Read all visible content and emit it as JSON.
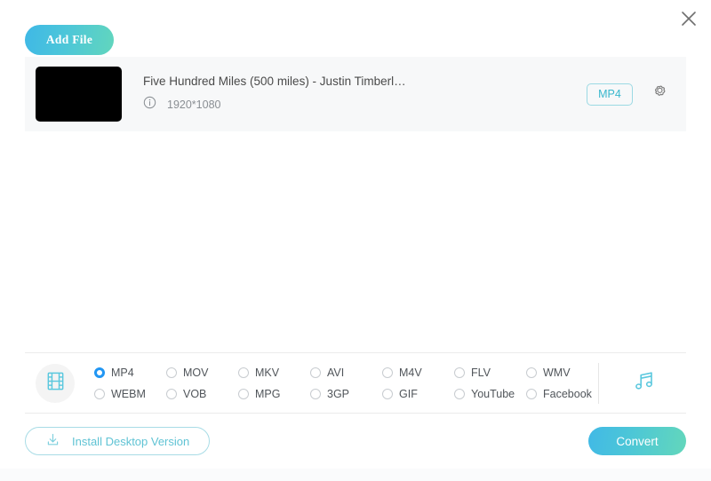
{
  "window": {
    "close_label": "×",
    "close_icon": "close-icon"
  },
  "toolbar": {
    "add_file_label": "Add File"
  },
  "file_list": {
    "items": [
      {
        "title": "Five Hundred Miles (500 miles) - Justin Timberl…",
        "resolution": "1920*1080",
        "format_badge": "MP4",
        "info_icon": "info-circle-icon",
        "settings_icon": "gear-icon",
        "thumbnail": "video-thumbnail"
      }
    ]
  },
  "format_section": {
    "video_icon": "film-strip-icon",
    "audio_icon": "music-note-icon",
    "selected": "MP4",
    "options": [
      {
        "label": "MP4",
        "selected": true
      },
      {
        "label": "MOV",
        "selected": false
      },
      {
        "label": "MKV",
        "selected": false
      },
      {
        "label": "AVI",
        "selected": false
      },
      {
        "label": "M4V",
        "selected": false
      },
      {
        "label": "FLV",
        "selected": false
      },
      {
        "label": "WMV",
        "selected": false
      },
      {
        "label": "WEBM",
        "selected": false
      },
      {
        "label": "VOB",
        "selected": false
      },
      {
        "label": "MPG",
        "selected": false
      },
      {
        "label": "3GP",
        "selected": false
      },
      {
        "label": "GIF",
        "selected": false
      },
      {
        "label": "YouTube",
        "selected": false
      },
      {
        "label": "Facebook",
        "selected": false
      }
    ]
  },
  "footer": {
    "install_label": "Install Desktop Version",
    "install_icon": "download-icon",
    "convert_label": "Convert"
  },
  "colors": {
    "accent_start": "#41b9e6",
    "accent_end": "#63d7bb",
    "cyan": "#5bc8de",
    "radio_selected": "#2196f3",
    "row_background": "#f7f8f9"
  }
}
